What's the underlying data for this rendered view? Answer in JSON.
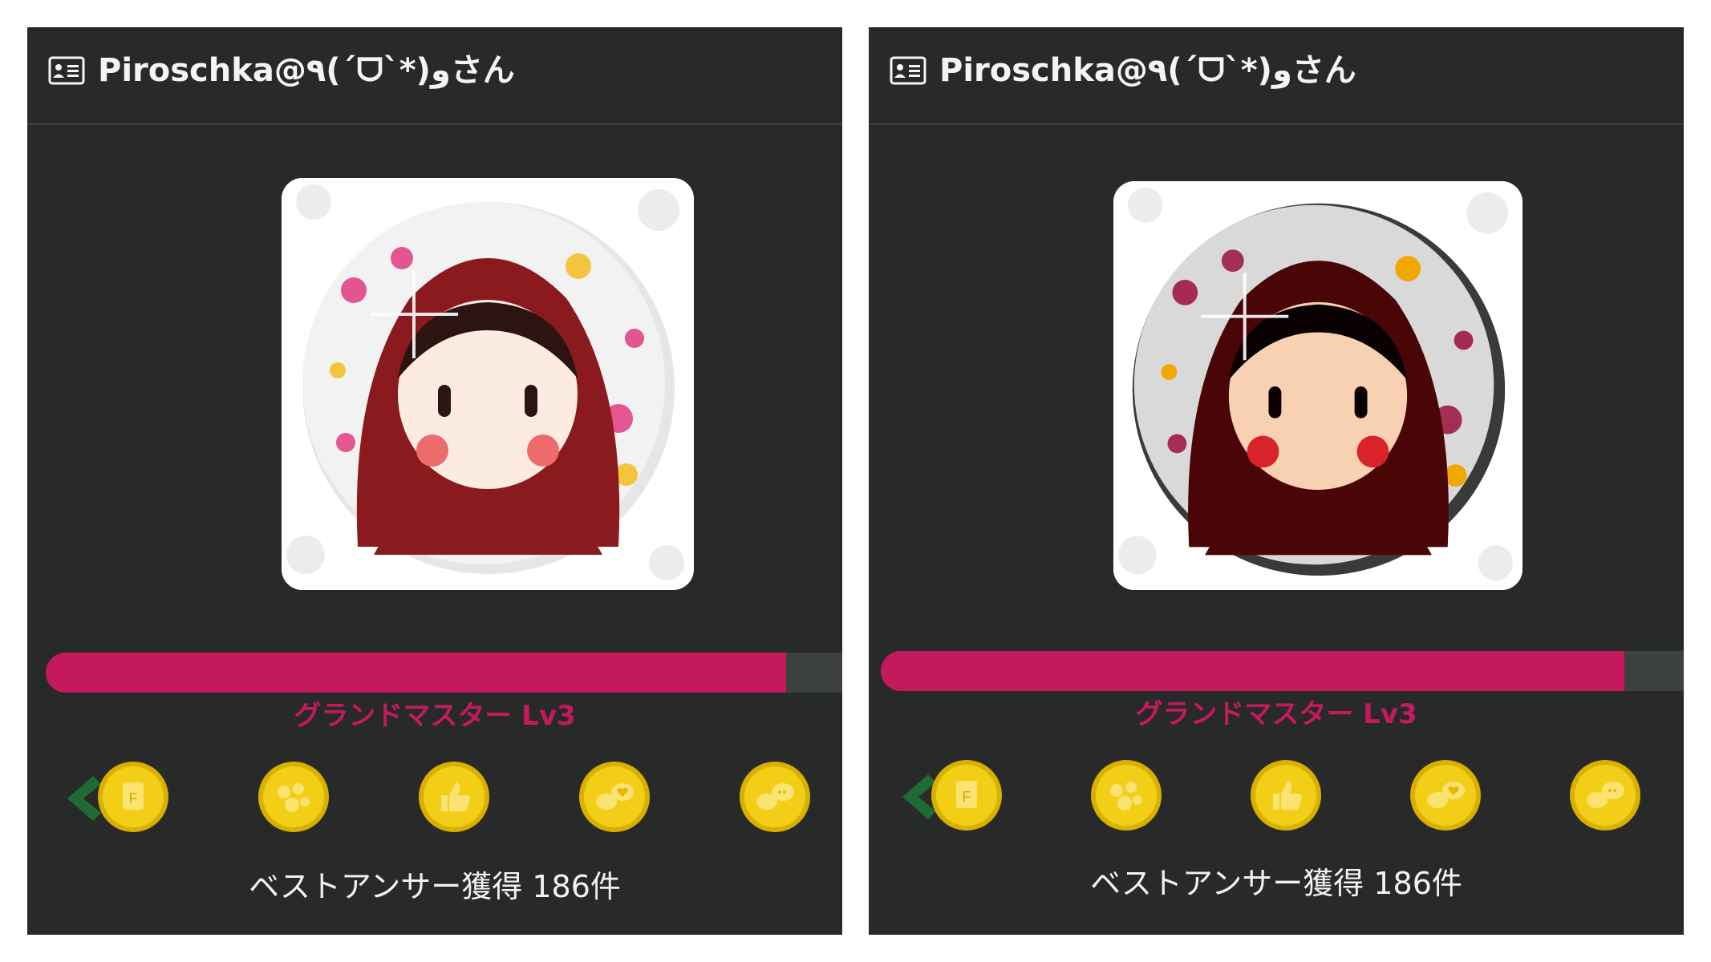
{
  "panels": [
    {
      "header": {
        "title": "Piroschka@٩(ˊᗜˋ*)وさん",
        "icon": "id-card-icon"
      },
      "avatar": {
        "description_icon": "avatar-red-hood-icon"
      },
      "level": {
        "label": "グランドマスター Lv3",
        "progress": 0.93
      },
      "badges": [
        "flag-badge-icon",
        "bubbles-badge-icon",
        "thumbs-up-badge-icon",
        "heart-chat-badge-icon",
        "chat-badge-icon"
      ],
      "best_answer_text": "ベストアンサー獲得 186件"
    },
    {
      "header": {
        "title": "Piroschka@٩(ˊᗜˋ*)وさん",
        "icon": "id-card-icon"
      },
      "avatar": {
        "description_icon": "avatar-red-hood-icon"
      },
      "level": {
        "label": "グランドマスター Lv3",
        "progress": 0.92
      },
      "badges": [
        "flag-badge-icon",
        "bubbles-badge-icon",
        "thumbs-up-badge-icon",
        "heart-chat-badge-icon",
        "chat-badge-icon"
      ],
      "best_answer_text": "ベストアンサー獲得 186件"
    }
  ],
  "colors": {
    "panel_bg": "#272a29",
    "accent": "#c5195e",
    "medal": "#f2cf16",
    "arrow": "#1f6b33"
  }
}
